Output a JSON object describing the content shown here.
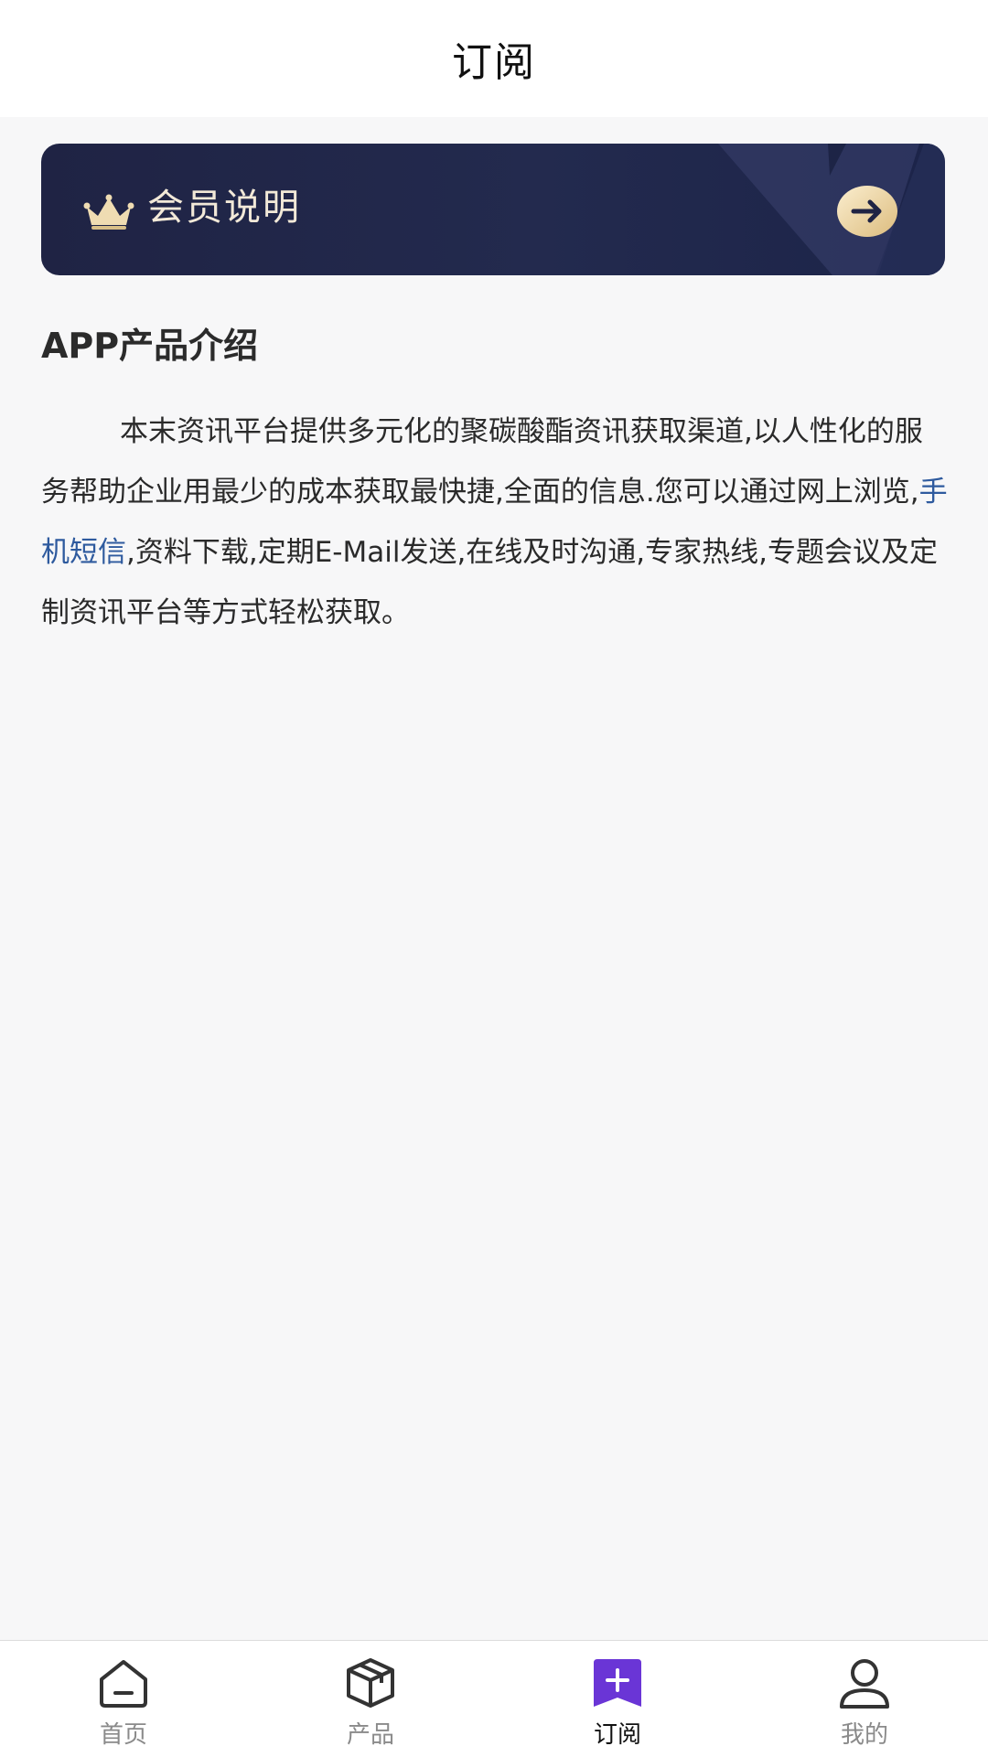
{
  "header": {
    "title": "订阅"
  },
  "banner": {
    "label": "会员说明",
    "icon": "crown-icon",
    "action_icon": "arrow-right-icon",
    "colors": {
      "background": "#1f2344",
      "accent_gold": "#e9d3a2",
      "text": "#f2e9d8"
    }
  },
  "intro": {
    "heading": "APP产品介绍",
    "body_before": "本末资讯平台提供多元化的聚碳酸酯资讯获取渠道,以人性化的服务帮助企业用最少的成本获取最快捷,全面的信息.您可以通过网上浏览,",
    "link_text": "手机短信",
    "body_after": ",资料下载,定期E-Mail发送,在线及时沟通,专家热线,专题会议及定制资讯平台等方式轻松获取。",
    "link_color": "#2e5a9e"
  },
  "tabbar": {
    "active_color": "#6a35d6",
    "items": [
      {
        "label": "首页",
        "icon": "home-icon",
        "active": false
      },
      {
        "label": "产品",
        "icon": "box-icon",
        "active": false
      },
      {
        "label": "订阅",
        "icon": "subscribe-plus-icon",
        "active": true
      },
      {
        "label": "我的",
        "icon": "user-icon",
        "active": false
      }
    ]
  }
}
